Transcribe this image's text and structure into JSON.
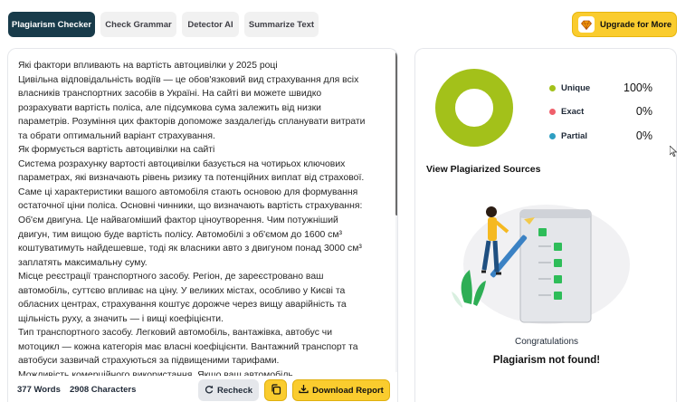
{
  "tabs": [
    {
      "label": "Plagiarism Checker",
      "active": true
    },
    {
      "label": "Check Grammar",
      "active": false
    },
    {
      "label": "Detector AI",
      "active": false
    },
    {
      "label": "Summarize Text",
      "active": false
    }
  ],
  "upgrade": {
    "label": "Upgrade for More"
  },
  "editor": {
    "lines": [
      "Які фактори впливають на вартість автоцивілки у 2025 році",
      "Цивільна відповідальність водіїв — це обов'язковий вид страхування для всіх",
      "власників транспортних засобів в Україні. На сайті ви можете швидко",
      "розрахувати вартість поліса, але підсумкова сума залежить від низки",
      "параметрів. Розуміння цих факторів допоможе заздалегідь спланувати витрати",
      "та обрати оптимальний варіант страхування.",
      "Як формується вартість автоцивілки на сайті",
      "Система розрахунку вартості автоцивілки базується на чотирьох ключових",
      "параметрах, які визначають рівень ризику та потенційних виплат від страхової.",
      "Саме ці характеристики вашого автомобіля стають основою для формування",
      "остаточної ціни поліса. Основні чинники, що визначають вартість страхування:",
      "Об'єм двигуна. Це найвагоміший фактор ціноутворення. Чим потужніший",
      "двигун, тим вищою буде вартість полісу. Автомобілі з об'ємом до 1600 см³",
      "коштуватимуть найдешевше, тоді як власники авто з двигуном понад 3000 см³",
      "заплатять максимальну суму.",
      "Місце реєстрації транспортного засобу. Регіон, де зареєстровано ваш",
      "автомобіль, суттєво впливає на ціну. У великих містах, особливо у Києві та",
      "обласних центрах, страхування коштує дорожче через вищу аварійність та",
      "щільність руху, а значить — і вищі коефіцієнти.",
      "Тип транспортного засобу. Легковий автомобіль, вантажівка, автобус чи",
      "мотоцикл — кожна категорія має власні коефіцієнти. Вантажний транспорт та",
      "автобуси зазвичай страхуються за підвищеними тарифами.",
      "Можливість комерційного використання. Якщо ваш автомобіль"
    ]
  },
  "stats": {
    "words": "377 Words",
    "characters": "2908 Characters"
  },
  "buttons": {
    "recheck": "Recheck",
    "copy_icon": "copy-icon",
    "download": "Download Report"
  },
  "results": {
    "chart_data": {
      "type": "pie",
      "categories": [
        "Unique",
        "Exact",
        "Partial"
      ],
      "values": [
        100,
        0,
        0
      ],
      "colors": [
        "#a3c11a",
        "#ef5f6b",
        "#2e9ec2"
      ]
    },
    "legend": [
      {
        "label": "Unique",
        "pct": "100%",
        "color": "#a3c11a"
      },
      {
        "label": "Exact",
        "pct": "0%",
        "color": "#ef5f6b"
      },
      {
        "label": "Partial",
        "pct": "0%",
        "color": "#2e9ec2"
      }
    ],
    "view_sources": "View Plagiarized Sources",
    "congrats": "Congratulations",
    "not_found": "Plagiarism not found!"
  },
  "colors": {
    "accent": "#facc2e",
    "active_tab": "#183b4a",
    "unique": "#a3c11a"
  }
}
